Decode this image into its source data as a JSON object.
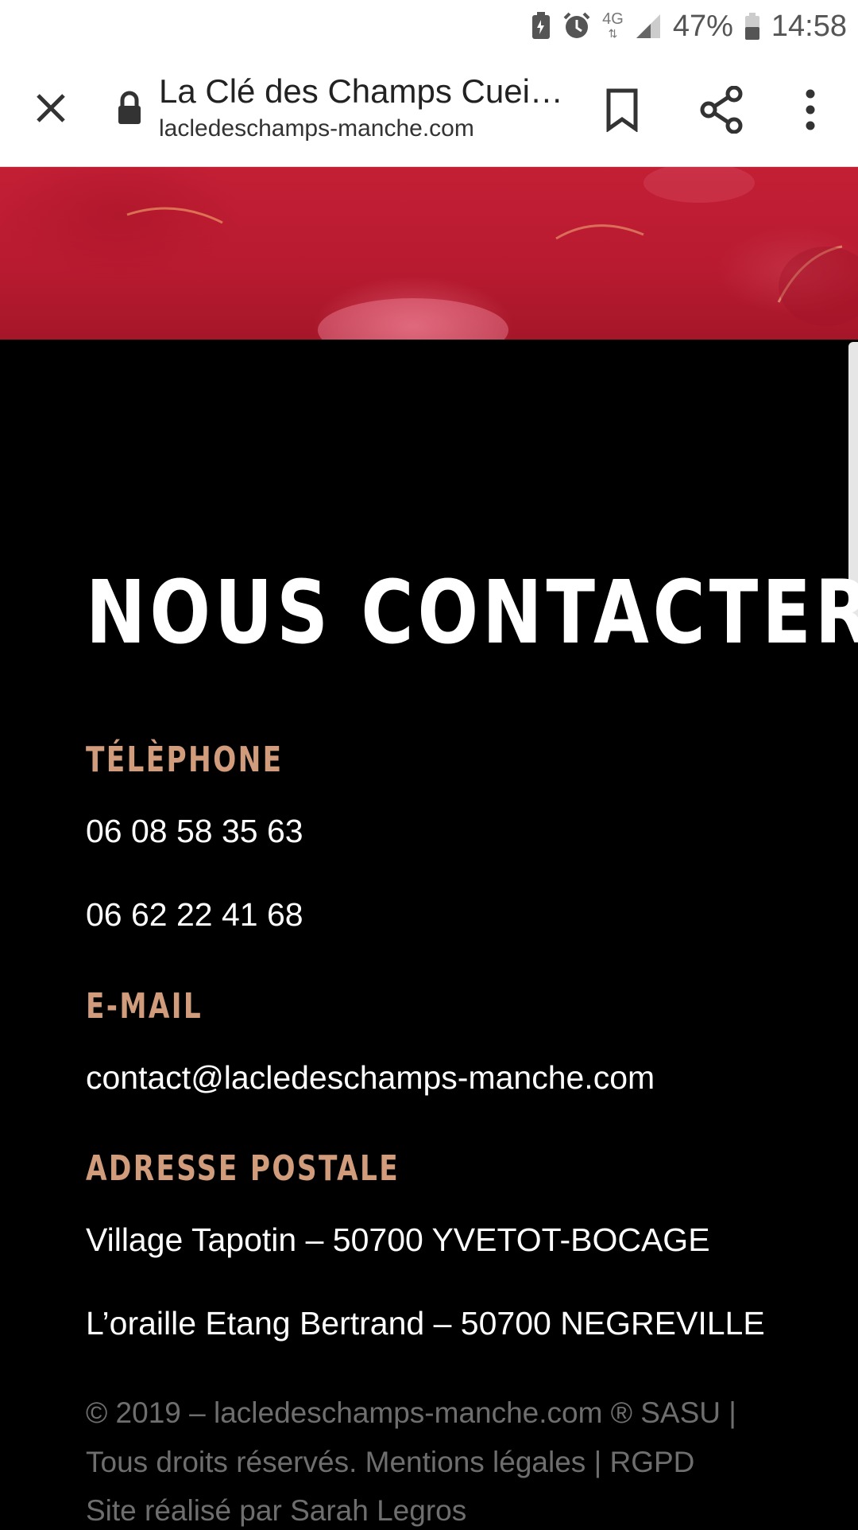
{
  "status_bar": {
    "network": "4G",
    "battery": "47%",
    "time": "14:58"
  },
  "browser": {
    "page_title": "La Clé des Champs Cueill...",
    "url": "lacledeschamps-manche.com"
  },
  "contact": {
    "heading": "NOUS CONTACTER",
    "phone_label": "TÉLÈPHONE",
    "phones": [
      "06 08 58 35 63",
      "06 62 22 41 68"
    ],
    "email_label": "E-MAIL",
    "email": "contact@lacledeschamps-manche.com",
    "address_label": "ADRESSE POSTALE",
    "addresses": [
      "Village Tapotin – 50700 YVETOT-BOCAGE",
      "L’oraille Etang Bertrand – 50700 NEGREVILLE"
    ]
  },
  "footer": {
    "copyright": "© 2019 – lacledeschamps-manche.com ® SASU |",
    "rights": "Tous droits réservés.",
    "legal_link": "Mentions légales",
    "separator": "|",
    "rgpd_link": "RGPD",
    "credit": "Site réalisé par Sarah Legros"
  },
  "colors": {
    "accent": "#d09c7c",
    "background": "#000000",
    "hero": "#c31f35"
  }
}
